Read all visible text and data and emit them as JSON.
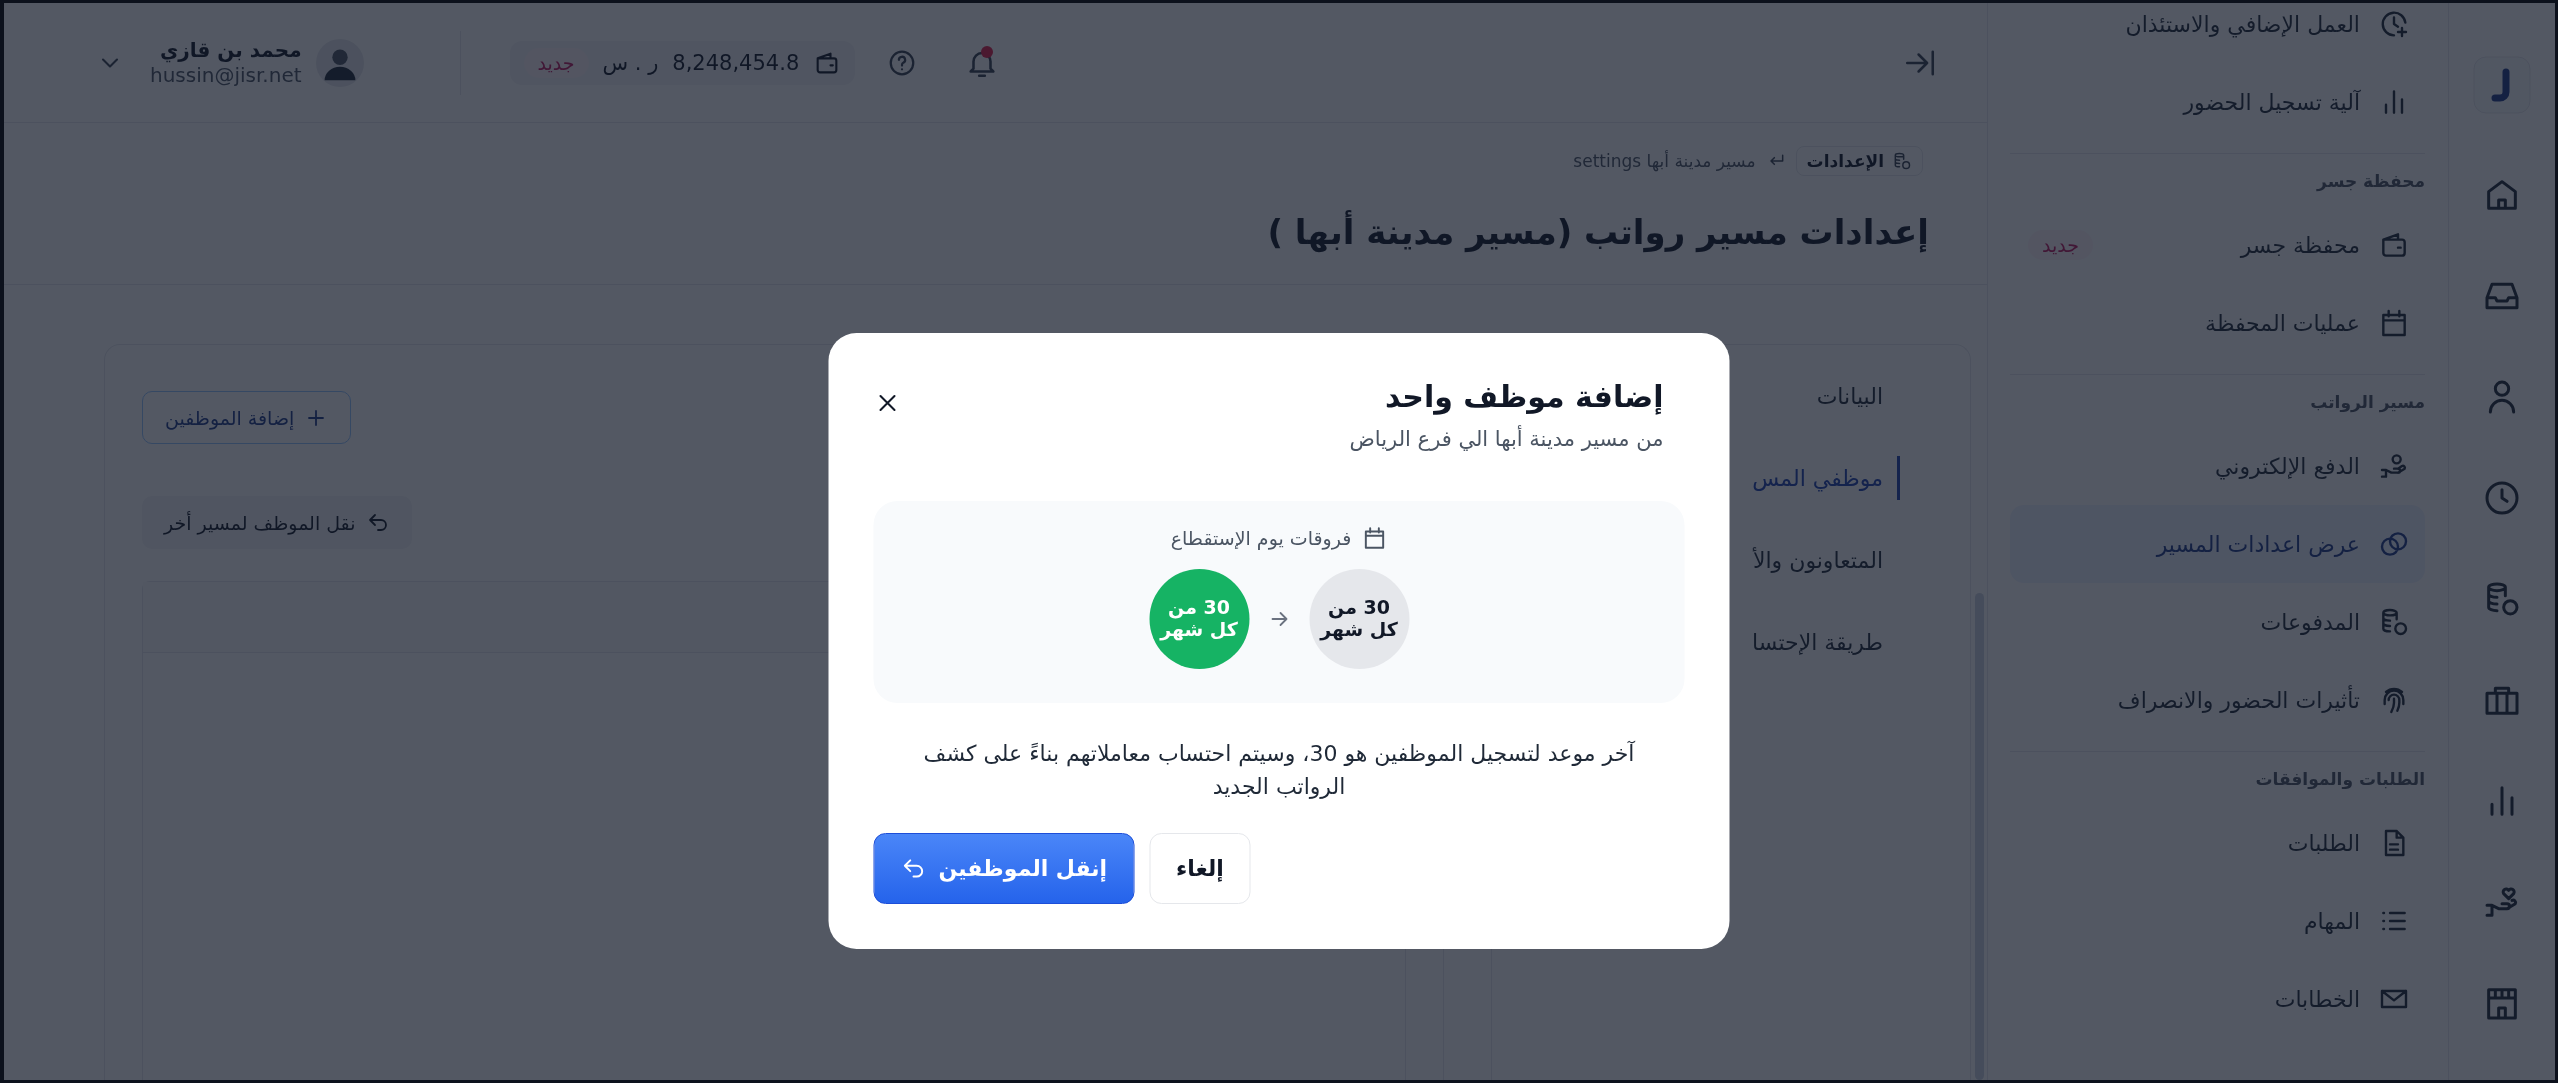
{
  "header": {
    "user": {
      "name": "محمد بن قازي",
      "email": "hussin@jisr.net"
    },
    "wallet": {
      "balance": "8,248,454.8",
      "currency": "ر . س",
      "badge": "جديد"
    },
    "notifications": {
      "unread": true
    }
  },
  "breadcrumb": [
    {
      "label": "الإعدادات"
    },
    {
      "label": "مسير مدينة أبها settings"
    }
  ],
  "page_title": "إعدادات مسير رواتب (مسير مدينة أبها )",
  "tabs": [
    {
      "label": "البيانات",
      "selected": false
    },
    {
      "label": "موظفي المس",
      "selected": true
    },
    {
      "label": "المتعاونون والأ",
      "selected": false
    },
    {
      "label": "طريقة الإحتسا",
      "selected": false
    }
  ],
  "actions": {
    "add_employees": "إضافة الموظفين",
    "move_employee": "نقل الموظف لمسير أخر"
  },
  "sidebar": {
    "sections": [
      {
        "items": [
          {
            "label": "العمل الإضافي والاستئذان",
            "selected": false
          },
          {
            "label": "آلية تسجيل الحضور",
            "selected": false
          }
        ]
      },
      {
        "title": "محفظة جسر",
        "items": [
          {
            "label": "محفظة جسر",
            "selected": false,
            "badge": "جديد"
          },
          {
            "label": "عمليات المحفظة",
            "selected": false
          }
        ]
      },
      {
        "title": "مسير الرواتب",
        "items": [
          {
            "label": "الدفع الإلكتروني",
            "selected": false
          },
          {
            "label": "عرض اعدادات المسير",
            "selected": true
          },
          {
            "label": "المدفوعات",
            "selected": false
          },
          {
            "label": "تأثيرات الحضور والانصراف",
            "selected": false
          }
        ]
      },
      {
        "title": "الطلبات والموافقات",
        "items": [
          {
            "label": "الطلبات",
            "selected": false
          },
          {
            "label": "المهام",
            "selected": false
          },
          {
            "label": "الخطابات",
            "selected": false
          }
        ]
      }
    ]
  },
  "modal": {
    "title": "إضافة موظف واحد",
    "subtitle": "من مسير مدينة أبها الي فرع الرياض",
    "deduction": {
      "label": "فروقات يوم الإستقطاع",
      "from": "30 من كل شهر",
      "to": "30 من كل شهر"
    },
    "note": "آخر موعد لتسجيل الموظفين هو 30، وسيتم احتساب معاملاتهم بناءً على كشف الرواتب الجديد",
    "buttons": [
      {
        "kind": "secondary",
        "label": "إلغاء"
      },
      {
        "kind": "primary",
        "label": "إنقل الموظفين"
      }
    ]
  }
}
